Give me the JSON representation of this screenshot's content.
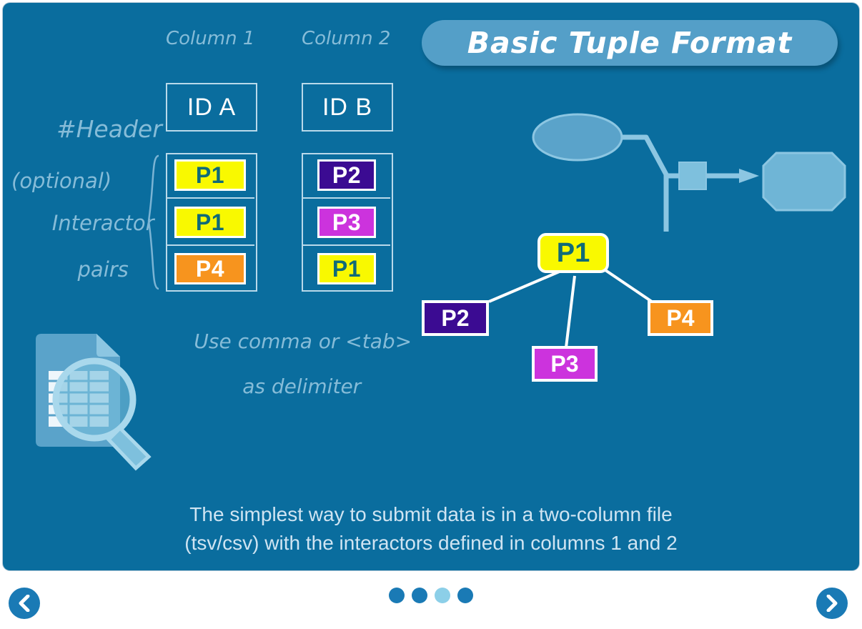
{
  "slide": {
    "title": "Basic Tuple Format",
    "background_color": "#0a6d9e",
    "title_pill_color": "#549fc8"
  },
  "annotations": {
    "column1": "Column 1",
    "column2": "Column 2",
    "header_line1": "#Header",
    "header_line2": "(optional)",
    "interactor_line1": "Interactor",
    "interactor_line2": "pairs",
    "delimiter_line1": "Use comma or <tab>",
    "delimiter_line2": "as delimiter"
  },
  "table": {
    "headers": [
      "ID A",
      "ID B"
    ],
    "rows": [
      {
        "a": "P1",
        "b": "P2"
      },
      {
        "a": "P1",
        "b": "P3"
      },
      {
        "a": "P4",
        "b": "P1"
      }
    ]
  },
  "chip_colors": {
    "P1": "#f9f900",
    "P2": "#3b0b92",
    "P3": "#cc33dd",
    "P4": "#f7941e",
    "P1_text": "#106b78",
    "other_text": "#ffffff"
  },
  "network": {
    "center": "P1",
    "neighbors": [
      "P2",
      "P3",
      "P4"
    ]
  },
  "caption": {
    "line1": "The simplest way to submit data is in a two-column file",
    "line2": "(tsv/csv) with the interactors defined in columns 1 and 2"
  },
  "nav": {
    "prev_icon": "chevron-left-icon",
    "next_icon": "chevron-right-icon",
    "dot_count": 4,
    "active_dot": 3
  }
}
